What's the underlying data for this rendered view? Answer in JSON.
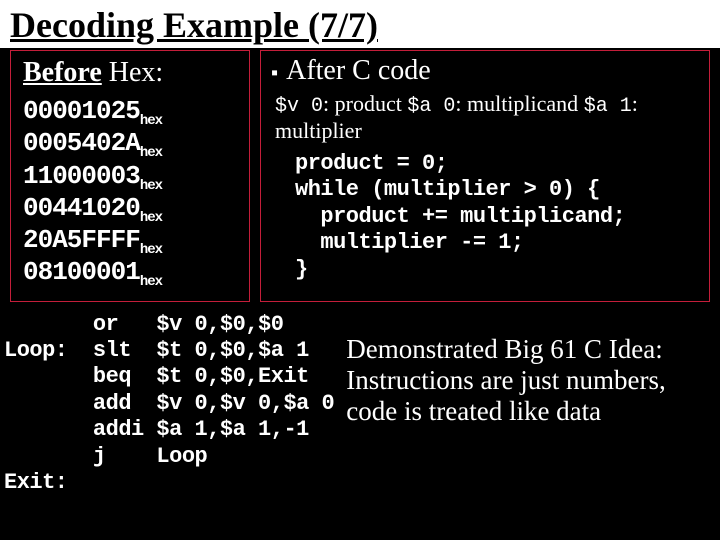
{
  "title": "Decoding Example (7/7)",
  "before": {
    "heading_bold": "Before",
    "heading_rest": " Hex:",
    "hex": [
      "00001025",
      "0005402A",
      "11000003",
      "00441020",
      "20A5FFFF",
      "08100001"
    ],
    "hex_suffix": "hex"
  },
  "after": {
    "heading": "After C code",
    "reg_v0": "$v 0",
    "reg_v0_desc": ": product ",
    "reg_a0": "$a 0",
    "reg_a0_desc": ": multiplicand ",
    "reg_a1": "$a 1",
    "reg_a1_desc": ": multiplier",
    "code": "product = 0;\nwhile (multiplier > 0) {\n  product += multiplicand;\n  multiplier -= 1;\n}"
  },
  "asm": "       or   $v 0,$0,$0\nLoop:  slt  $t 0,$0,$a 1\n       beq  $t 0,$0,Exit\n       add  $v 0,$v 0,$a 0\n       addi $a 1,$a 1,-1\n       j    Loop\nExit:",
  "idea": "Demonstrated Big 61 C Idea: Instructions are just numbers, code is treated like data"
}
